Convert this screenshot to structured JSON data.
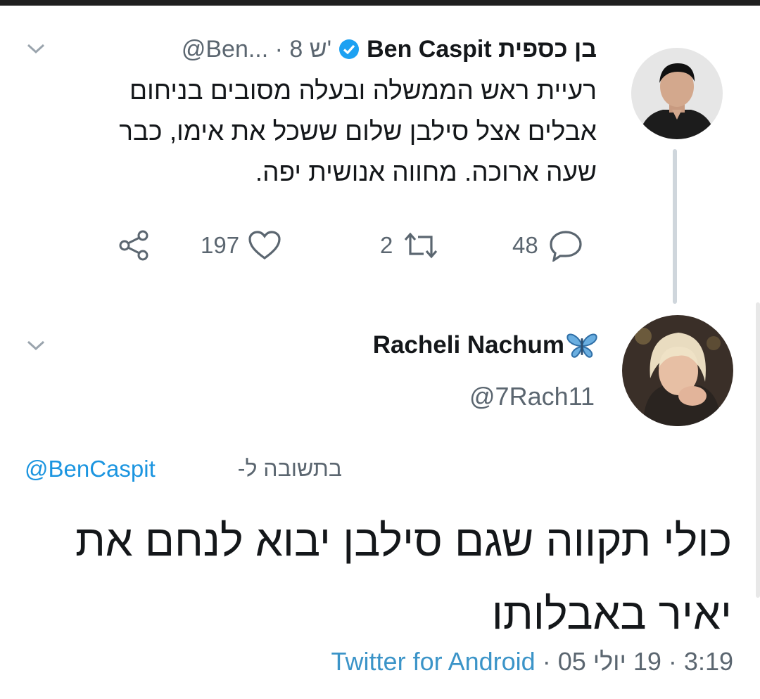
{
  "tweet1": {
    "name": "Ben Caspit בן כספית",
    "handle": "@Ben...",
    "time": "8 ש'",
    "text_lines": [
      "רעיית ראש הממשלה ובעלה מסובים בניחום",
      "אבלים אצל סילבן שלום ששכל את אימו, כבר",
      "שעה ארוכה. מחווה אנושית יפה."
    ],
    "verified": true,
    "actions": {
      "replies": "48",
      "retweets": "2",
      "likes": "197"
    }
  },
  "tweet2": {
    "name": "Racheli Nachum",
    "name_emoji": "butterfly-icon",
    "handle": "@7Rach11",
    "reply_prefix": "בתשובה ל-",
    "reply_handle": "@BenCaspit",
    "text_lines": [
      "כולי תקווה שגם סילבן יבוא לנחם את",
      "יאיר באבלותו"
    ],
    "source": "Twitter for Android",
    "date": "19 יולי 05",
    "time": "3:19",
    "separator": "·"
  },
  "colors": {
    "link": "#1b95e0",
    "muted": "#5b6670",
    "verified": "#1da1f2",
    "butterfly": "#4a90c8"
  }
}
